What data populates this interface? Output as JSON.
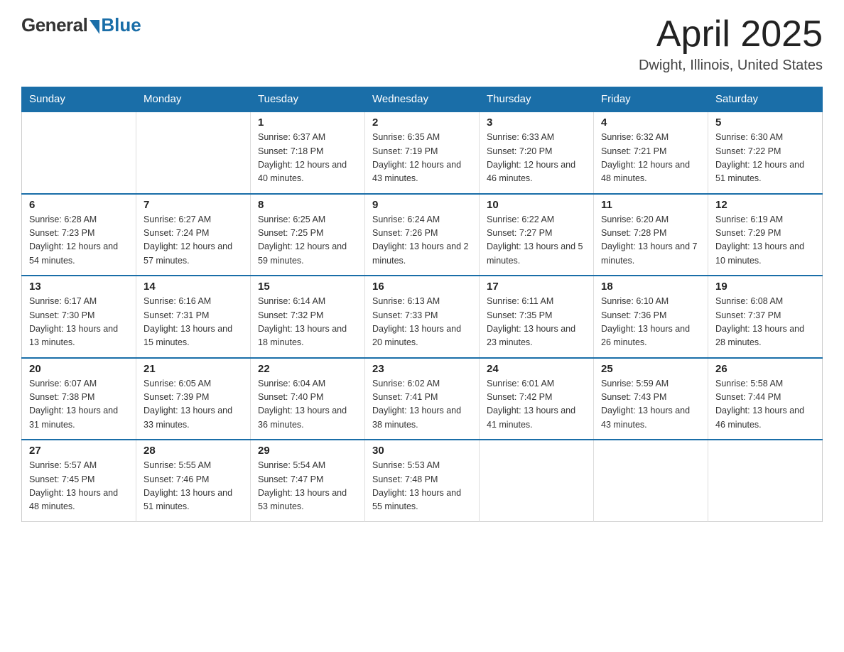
{
  "header": {
    "logo_general": "General",
    "logo_blue": "Blue",
    "title": "April 2025",
    "subtitle": "Dwight, Illinois, United States"
  },
  "days_of_week": [
    "Sunday",
    "Monday",
    "Tuesday",
    "Wednesday",
    "Thursday",
    "Friday",
    "Saturday"
  ],
  "weeks": [
    [
      {
        "day": "",
        "sunrise": "",
        "sunset": "",
        "daylight": ""
      },
      {
        "day": "",
        "sunrise": "",
        "sunset": "",
        "daylight": ""
      },
      {
        "day": "1",
        "sunrise": "Sunrise: 6:37 AM",
        "sunset": "Sunset: 7:18 PM",
        "daylight": "Daylight: 12 hours and 40 minutes."
      },
      {
        "day": "2",
        "sunrise": "Sunrise: 6:35 AM",
        "sunset": "Sunset: 7:19 PM",
        "daylight": "Daylight: 12 hours and 43 minutes."
      },
      {
        "day": "3",
        "sunrise": "Sunrise: 6:33 AM",
        "sunset": "Sunset: 7:20 PM",
        "daylight": "Daylight: 12 hours and 46 minutes."
      },
      {
        "day": "4",
        "sunrise": "Sunrise: 6:32 AM",
        "sunset": "Sunset: 7:21 PM",
        "daylight": "Daylight: 12 hours and 48 minutes."
      },
      {
        "day": "5",
        "sunrise": "Sunrise: 6:30 AM",
        "sunset": "Sunset: 7:22 PM",
        "daylight": "Daylight: 12 hours and 51 minutes."
      }
    ],
    [
      {
        "day": "6",
        "sunrise": "Sunrise: 6:28 AM",
        "sunset": "Sunset: 7:23 PM",
        "daylight": "Daylight: 12 hours and 54 minutes."
      },
      {
        "day": "7",
        "sunrise": "Sunrise: 6:27 AM",
        "sunset": "Sunset: 7:24 PM",
        "daylight": "Daylight: 12 hours and 57 minutes."
      },
      {
        "day": "8",
        "sunrise": "Sunrise: 6:25 AM",
        "sunset": "Sunset: 7:25 PM",
        "daylight": "Daylight: 12 hours and 59 minutes."
      },
      {
        "day": "9",
        "sunrise": "Sunrise: 6:24 AM",
        "sunset": "Sunset: 7:26 PM",
        "daylight": "Daylight: 13 hours and 2 minutes."
      },
      {
        "day": "10",
        "sunrise": "Sunrise: 6:22 AM",
        "sunset": "Sunset: 7:27 PM",
        "daylight": "Daylight: 13 hours and 5 minutes."
      },
      {
        "day": "11",
        "sunrise": "Sunrise: 6:20 AM",
        "sunset": "Sunset: 7:28 PM",
        "daylight": "Daylight: 13 hours and 7 minutes."
      },
      {
        "day": "12",
        "sunrise": "Sunrise: 6:19 AM",
        "sunset": "Sunset: 7:29 PM",
        "daylight": "Daylight: 13 hours and 10 minutes."
      }
    ],
    [
      {
        "day": "13",
        "sunrise": "Sunrise: 6:17 AM",
        "sunset": "Sunset: 7:30 PM",
        "daylight": "Daylight: 13 hours and 13 minutes."
      },
      {
        "day": "14",
        "sunrise": "Sunrise: 6:16 AM",
        "sunset": "Sunset: 7:31 PM",
        "daylight": "Daylight: 13 hours and 15 minutes."
      },
      {
        "day": "15",
        "sunrise": "Sunrise: 6:14 AM",
        "sunset": "Sunset: 7:32 PM",
        "daylight": "Daylight: 13 hours and 18 minutes."
      },
      {
        "day": "16",
        "sunrise": "Sunrise: 6:13 AM",
        "sunset": "Sunset: 7:33 PM",
        "daylight": "Daylight: 13 hours and 20 minutes."
      },
      {
        "day": "17",
        "sunrise": "Sunrise: 6:11 AM",
        "sunset": "Sunset: 7:35 PM",
        "daylight": "Daylight: 13 hours and 23 minutes."
      },
      {
        "day": "18",
        "sunrise": "Sunrise: 6:10 AM",
        "sunset": "Sunset: 7:36 PM",
        "daylight": "Daylight: 13 hours and 26 minutes."
      },
      {
        "day": "19",
        "sunrise": "Sunrise: 6:08 AM",
        "sunset": "Sunset: 7:37 PM",
        "daylight": "Daylight: 13 hours and 28 minutes."
      }
    ],
    [
      {
        "day": "20",
        "sunrise": "Sunrise: 6:07 AM",
        "sunset": "Sunset: 7:38 PM",
        "daylight": "Daylight: 13 hours and 31 minutes."
      },
      {
        "day": "21",
        "sunrise": "Sunrise: 6:05 AM",
        "sunset": "Sunset: 7:39 PM",
        "daylight": "Daylight: 13 hours and 33 minutes."
      },
      {
        "day": "22",
        "sunrise": "Sunrise: 6:04 AM",
        "sunset": "Sunset: 7:40 PM",
        "daylight": "Daylight: 13 hours and 36 minutes."
      },
      {
        "day": "23",
        "sunrise": "Sunrise: 6:02 AM",
        "sunset": "Sunset: 7:41 PM",
        "daylight": "Daylight: 13 hours and 38 minutes."
      },
      {
        "day": "24",
        "sunrise": "Sunrise: 6:01 AM",
        "sunset": "Sunset: 7:42 PM",
        "daylight": "Daylight: 13 hours and 41 minutes."
      },
      {
        "day": "25",
        "sunrise": "Sunrise: 5:59 AM",
        "sunset": "Sunset: 7:43 PM",
        "daylight": "Daylight: 13 hours and 43 minutes."
      },
      {
        "day": "26",
        "sunrise": "Sunrise: 5:58 AM",
        "sunset": "Sunset: 7:44 PM",
        "daylight": "Daylight: 13 hours and 46 minutes."
      }
    ],
    [
      {
        "day": "27",
        "sunrise": "Sunrise: 5:57 AM",
        "sunset": "Sunset: 7:45 PM",
        "daylight": "Daylight: 13 hours and 48 minutes."
      },
      {
        "day": "28",
        "sunrise": "Sunrise: 5:55 AM",
        "sunset": "Sunset: 7:46 PM",
        "daylight": "Daylight: 13 hours and 51 minutes."
      },
      {
        "day": "29",
        "sunrise": "Sunrise: 5:54 AM",
        "sunset": "Sunset: 7:47 PM",
        "daylight": "Daylight: 13 hours and 53 minutes."
      },
      {
        "day": "30",
        "sunrise": "Sunrise: 5:53 AM",
        "sunset": "Sunset: 7:48 PM",
        "daylight": "Daylight: 13 hours and 55 minutes."
      },
      {
        "day": "",
        "sunrise": "",
        "sunset": "",
        "daylight": ""
      },
      {
        "day": "",
        "sunrise": "",
        "sunset": "",
        "daylight": ""
      },
      {
        "day": "",
        "sunrise": "",
        "sunset": "",
        "daylight": ""
      }
    ]
  ]
}
